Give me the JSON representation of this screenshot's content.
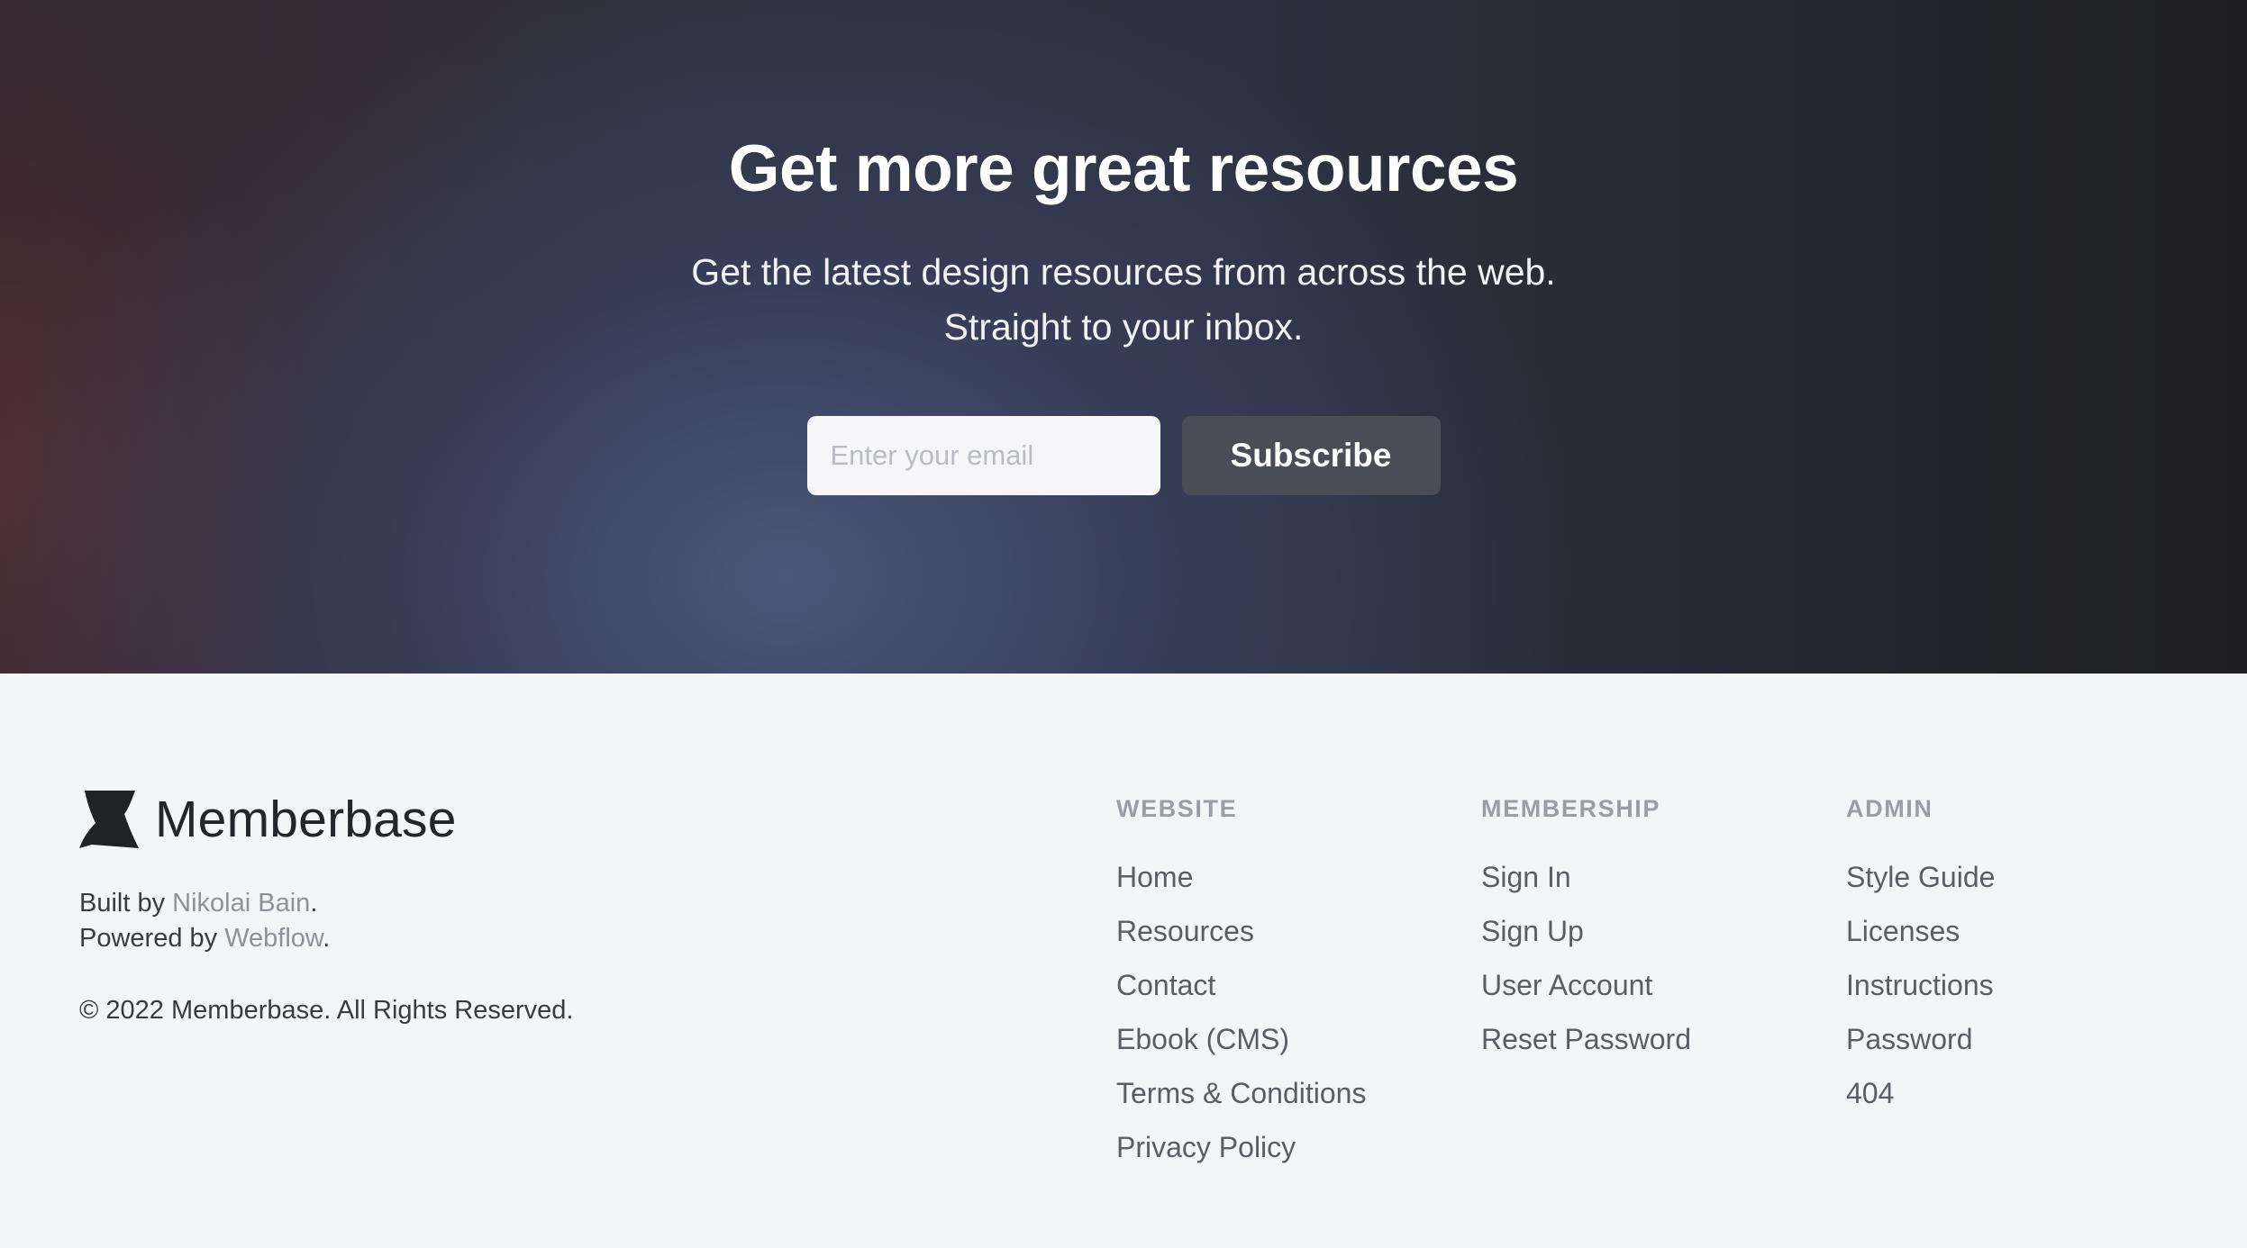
{
  "hero": {
    "title": "Get more great resources",
    "subtitle_line1": "Get the latest design resources from across the web.",
    "subtitle_line2": "Straight to your inbox.",
    "email_placeholder": "Enter your email",
    "subscribe_label": "Subscribe"
  },
  "footer": {
    "brand_name": "Memberbase",
    "built_by_prefix": "Built by ",
    "built_by_name": "Nikolai Bain",
    "powered_by_prefix": "Powered by ",
    "powered_by_name": "Webflow",
    "period": ".",
    "copyright": "© 2022 Memberbase. All Rights Reserved.",
    "columns": [
      {
        "heading": "WEBSITE",
        "links": [
          "Home",
          "Resources",
          "Contact",
          "Ebook (CMS)",
          "Terms & Conditions",
          "Privacy Policy"
        ]
      },
      {
        "heading": "MEMBERSHIP",
        "links": [
          "Sign In",
          "Sign Up",
          "User Account",
          "Reset Password"
        ]
      },
      {
        "heading": "ADMIN",
        "links": [
          "Style Guide",
          "Licenses",
          "Instructions",
          "Password",
          "404"
        ]
      }
    ]
  },
  "colors": {
    "hero_dark": "#1f1f21",
    "hero_accent": "#4c5a82",
    "button_bg": "#4a4d55",
    "footer_bg": "#f4f5f7",
    "link_muted": "#8e9198"
  },
  "icons": {
    "logo": "memberbase-logo-mark"
  }
}
